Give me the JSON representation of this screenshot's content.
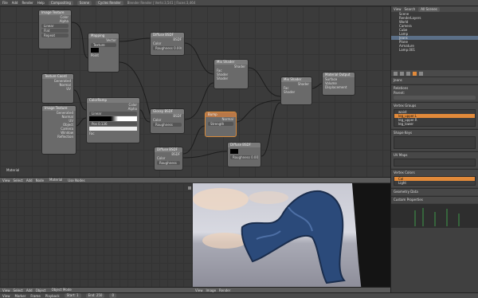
{
  "topbar": {
    "menus": [
      "File",
      "Add",
      "Render",
      "Help"
    ],
    "layout": "Compositing",
    "scene": "Scene",
    "engine": "Cycles Render",
    "stats": "Blender Render | Verts:3,541 | Faces:3,464"
  },
  "node_editor": {
    "status_label": "Material",
    "menus": [
      "View",
      "Select",
      "Add",
      "Node"
    ],
    "material_name": "Material",
    "use_nodes_label": "Use Nodes",
    "nodes": {
      "image_texture_1": {
        "title": "Image Texture",
        "rows": [
          "Color",
          "Alpha",
          "Linear",
          "Flat",
          "Repeat"
        ]
      },
      "mapping": {
        "title": "Mapping",
        "rows": [
          "Vector",
          "Texture",
          "Point"
        ]
      },
      "diffuse_1": {
        "title": "Diffuse BSDF",
        "rows": [
          "BSDF",
          "Color",
          "Roughness 0.000",
          "Normal"
        ]
      },
      "mix_shader_1": {
        "title": "Mix Shader",
        "rows": [
          "Shader",
          "Fac",
          "Shader",
          "Shader"
        ]
      },
      "material_output": {
        "title": "Material Output",
        "rows": [
          "Surface",
          "Volume",
          "Displacement"
        ]
      },
      "tex_coord": {
        "title": "Texture Coord",
        "rows": [
          "Generated",
          "Normal",
          "UV"
        ]
      },
      "image_texture_2": {
        "title": "Image Texture",
        "rows": [
          "Generated",
          "Normal",
          "UV",
          "Object",
          "Camera",
          "Window",
          "Reflection"
        ]
      },
      "color_ramp": {
        "title": "ColorRamp",
        "rows": [
          "Color",
          "Alpha",
          "Linear",
          "Pos 0.136",
          "Fac"
        ]
      },
      "glossy": {
        "title": "Glossy BSDF",
        "rows": [
          "BSDF",
          "Color",
          "Roughness"
        ]
      },
      "mix_shader_2": {
        "title": "Mix Shader",
        "rows": [
          "Shader",
          "Fac",
          "Shader"
        ]
      },
      "bump": {
        "title": "Bump",
        "rows": [
          "Normal",
          "Strength"
        ]
      },
      "diffuse_2": {
        "title": "Diffuse BSDF",
        "rows": [
          "BSDF",
          "Color",
          "Roughness"
        ]
      }
    }
  },
  "viewport": {
    "menus": [
      "View",
      "Select",
      "Add",
      "Object"
    ],
    "mode": "Object Mode"
  },
  "render_view": {
    "menus": [
      "View",
      "Image",
      "Render"
    ]
  },
  "outliner": {
    "header": [
      "View",
      "Search",
      "All Scenes"
    ],
    "items": [
      "Scene",
      "RenderLayers",
      "World",
      "Camera",
      "Cube",
      "Lamp",
      "Jeans",
      "Plane",
      "Armature",
      "Lamp.001"
    ]
  },
  "properties": {
    "object_name": "Jeans",
    "panels": {
      "relations": "Relations",
      "parent_label": "Parent:",
      "vertex_groups": "Vertex Groups",
      "vg_items": [
        "waist",
        "leg_upper.L",
        "leg_upper.R",
        "leg_lower"
      ],
      "shape_keys": "Shape Keys",
      "uv_maps": "UV Maps",
      "vertex_colors": "Vertex Colors",
      "vc_items": [
        "Col",
        "Light"
      ],
      "geometry_data": "Geometry Data",
      "custom_properties": "Custom Properties"
    }
  },
  "bottombar": {
    "items": [
      "View",
      "Marker",
      "Frame",
      "Playback",
      "Start: 1",
      "End: 250",
      "0"
    ]
  },
  "colors": {
    "selection": "#e28a3a",
    "jeans": "#2b4a7a"
  }
}
